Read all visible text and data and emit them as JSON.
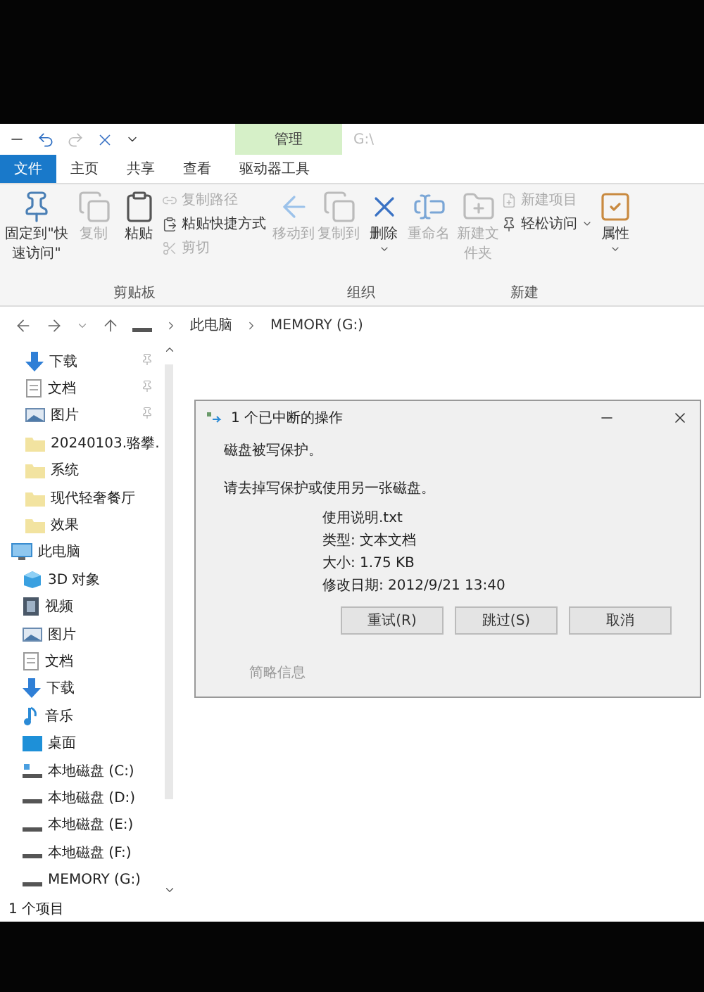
{
  "title_bar": {
    "context_tab": "管理",
    "path": "G:\\"
  },
  "tabs": [
    {
      "label": "文件",
      "selected": true
    },
    {
      "label": "主页",
      "selected": false
    },
    {
      "label": "共享",
      "selected": false
    },
    {
      "label": "查看",
      "selected": false
    },
    {
      "label": "驱动器工具",
      "selected": false
    }
  ],
  "ribbon": [
    {
      "label": "剪贴板",
      "items": [
        {
          "kind": "large",
          "label": "固定到\"快速访问\"",
          "disabled": false,
          "menu": false
        },
        {
          "kind": "large",
          "label": "复制",
          "disabled": true,
          "menu": false
        },
        {
          "kind": "large",
          "label": "粘贴",
          "disabled": false,
          "menu": false
        },
        {
          "kind": "stack",
          "items": [
            {
              "label": "复制路径",
              "disabled": true,
              "menu": false
            },
            {
              "label": "粘贴快捷方式",
              "disabled": false,
              "menu": false
            },
            {
              "label": "剪切",
              "disabled": true,
              "menu": false
            }
          ]
        }
      ]
    },
    {
      "label": "组织",
      "items": [
        {
          "kind": "large",
          "label": "移动到",
          "disabled": true,
          "menu": false
        },
        {
          "kind": "large",
          "label": "复制到",
          "disabled": true,
          "menu": false
        },
        {
          "kind": "large",
          "label": "删除",
          "disabled": false,
          "menu": true
        },
        {
          "kind": "large",
          "label": "重命名",
          "disabled": true,
          "menu": false
        }
      ]
    },
    {
      "label": "新建",
      "items": [
        {
          "kind": "large",
          "label": "新建文件夹",
          "disabled": true,
          "menu": false
        },
        {
          "kind": "stack",
          "items": [
            {
              "label": "新建项目",
              "disabled": true,
              "menu": false
            },
            {
              "label": "轻松访问",
              "disabled": false,
              "menu": true
            }
          ]
        }
      ]
    },
    {
      "items": [
        {
          "kind": "large",
          "label": "属性",
          "disabled": false,
          "menu": true
        }
      ]
    }
  ],
  "address": {
    "crumbs": [
      "此电脑",
      "MEMORY (G:)"
    ]
  },
  "nav": [
    {
      "label": "下载",
      "kind": "download",
      "pinned": true
    },
    {
      "label": "文档",
      "kind": "document",
      "pinned": true
    },
    {
      "label": "图片",
      "kind": "picture",
      "pinned": true
    },
    {
      "label": "20240103.骆攀.",
      "kind": "folder",
      "pinned": false
    },
    {
      "label": "系统",
      "kind": "folder",
      "pinned": false
    },
    {
      "label": "现代轻奢餐厅",
      "kind": "folder",
      "pinned": false
    },
    {
      "label": "效果",
      "kind": "folder",
      "pinned": false
    },
    {
      "label": "此电脑",
      "kind": "pc",
      "pinned": false,
      "children": [
        {
          "label": "3D 对象",
          "kind": "cube",
          "pinned": false
        },
        {
          "label": "视频",
          "kind": "video",
          "pinned": false
        },
        {
          "label": "图片",
          "kind": "picture",
          "pinned": false
        },
        {
          "label": "文档",
          "kind": "document",
          "pinned": false
        },
        {
          "label": "下载",
          "kind": "download",
          "pinned": false
        },
        {
          "label": "音乐",
          "kind": "music",
          "pinned": false
        },
        {
          "label": "桌面",
          "kind": "desktop",
          "pinned": false
        },
        {
          "label": "本地磁盘 (C:)",
          "kind": "system-drive",
          "pinned": false
        },
        {
          "label": "本地磁盘 (D:)",
          "kind": "drive",
          "pinned": false
        },
        {
          "label": "本地磁盘 (E:)",
          "kind": "drive",
          "pinned": false
        },
        {
          "label": "本地磁盘 (F:)",
          "kind": "drive",
          "pinned": false
        },
        {
          "label": "MEMORY (G:)",
          "kind": "drive",
          "pinned": false
        }
      ]
    }
  ],
  "status_bar": "1 个项目",
  "dialog": {
    "title": "1 个已中断的操作",
    "message": "磁盘被写保护。",
    "instruction": "请去掉写保护或使用另一张磁盘。",
    "details": [
      "使用说明.txt",
      "类型: 文本文档",
      "大小: 1.75 KB",
      "修改日期: 2012/9/21 13:40"
    ],
    "buttons": [
      "重试(R)",
      "跳过(S)",
      "取消"
    ],
    "link": "简略信息"
  }
}
